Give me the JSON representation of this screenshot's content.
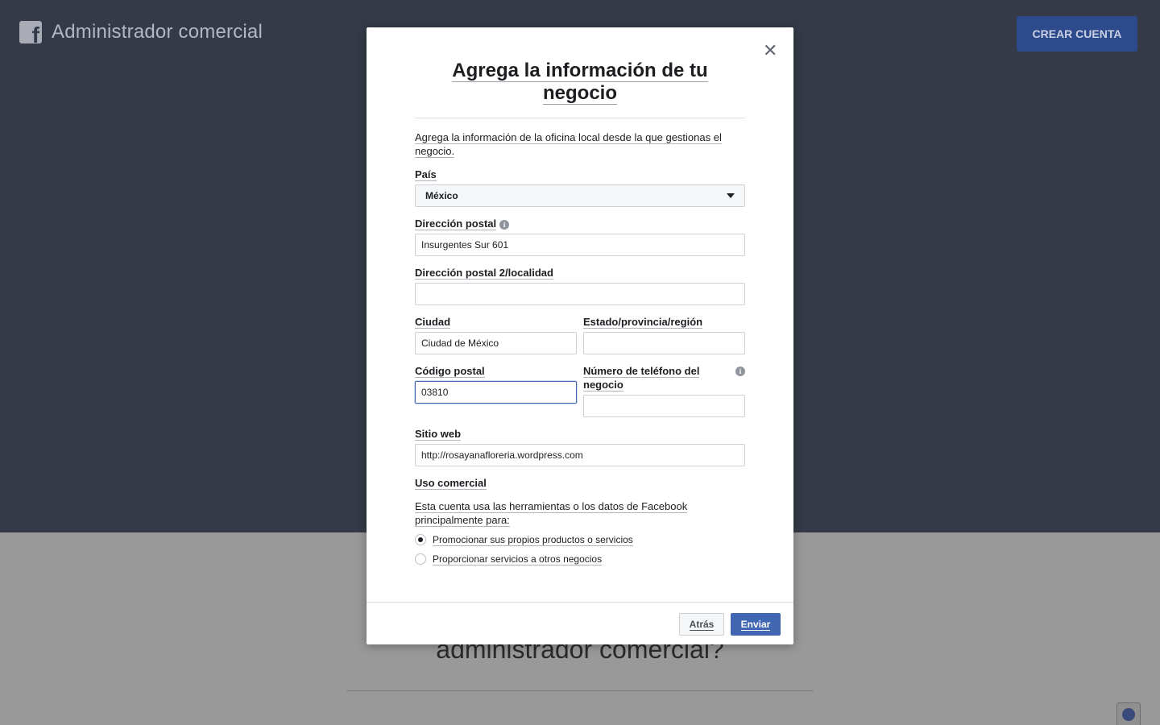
{
  "header": {
    "logo_glyph": "f",
    "title": "Administrador comercial",
    "create_account_label": "CREAR CUENTA"
  },
  "background": {
    "heading": "administrador comercial?",
    "globe_icon": "globe-icon"
  },
  "modal": {
    "title": "Agrega la información de tu negocio",
    "close_glyph": "✕",
    "intro": "Agrega la información de la oficina local desde la que gestionas el negocio.",
    "country": {
      "label": "País",
      "value": "México"
    },
    "address1": {
      "label": "Dirección postal",
      "value": "Insurgentes Sur 601",
      "info_glyph": "i"
    },
    "address2": {
      "label": "Dirección postal 2/localidad",
      "value": ""
    },
    "city": {
      "label": "Ciudad",
      "value": "Ciudad de México"
    },
    "state": {
      "label": "Estado/provincia/región",
      "value": ""
    },
    "postal": {
      "label": "Código postal",
      "value": "03810"
    },
    "phone": {
      "label": "Número de teléfono del negocio",
      "value": "",
      "info_glyph": "i"
    },
    "website": {
      "label": "Sitio web",
      "value": "http://rosayanafloreria.wordpress.com"
    },
    "usage": {
      "label": "Uso comercial",
      "question": "Esta cuenta usa las herramientas o los datos de Facebook principalmente para:",
      "options": [
        {
          "label": "Promocionar sus propios productos o servicios",
          "selected": true
        },
        {
          "label": "Proporcionar servicios a otros negocios",
          "selected": false
        }
      ]
    },
    "back_label": "Atrás",
    "send_label": "Enviar"
  },
  "colors": {
    "accent": "#4267b2",
    "header_bg": "#353a48",
    "create_button_bg": "#2d4a8c"
  }
}
